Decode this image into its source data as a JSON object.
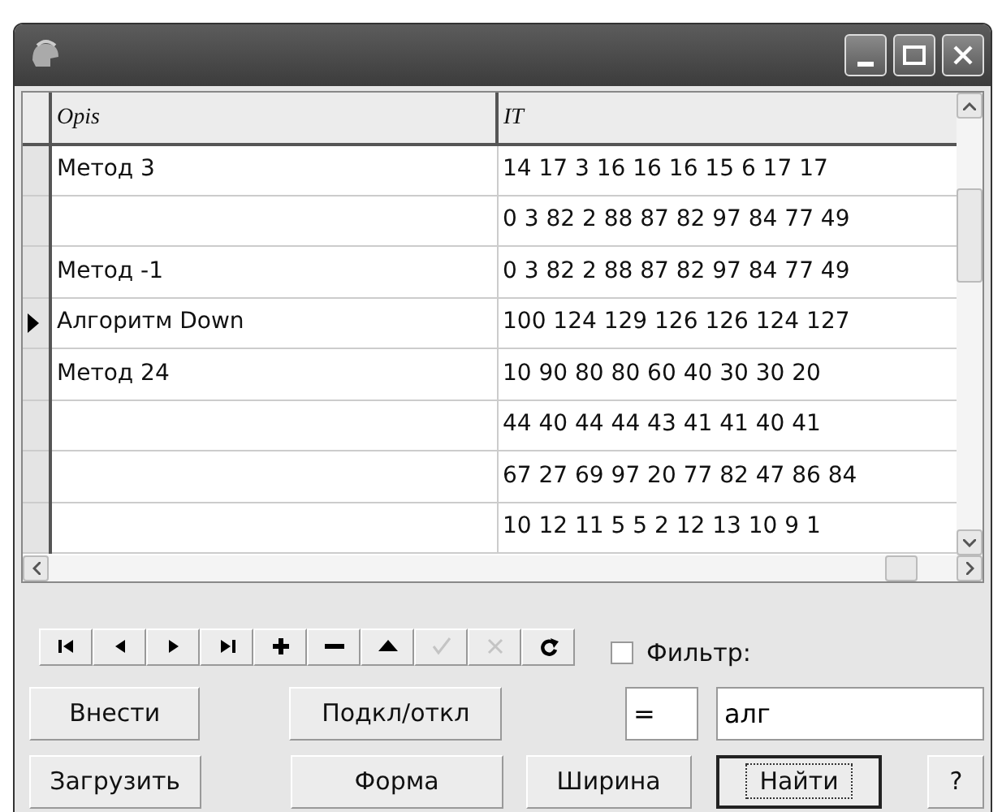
{
  "table": {
    "columns": [
      "Opis",
      "IT"
    ],
    "rows": [
      {
        "opis": "Метод 3",
        "it": "14 17 3 16 16 16 15 6 17 17",
        "current": false
      },
      {
        "opis": "",
        "it": "0 3 82 2 88 87 82 97 84 77 49",
        "current": false
      },
      {
        "opis": "Метод -1",
        "it": "0 3 82 2 88 87 82 97 84 77 49",
        "current": false
      },
      {
        "opis": "Алгоритм Down",
        "it": "100 124 129 126 126 124 127",
        "current": true
      },
      {
        "opis": "Метод 24",
        "it": "10 90 80 80 60 40 30 30 20",
        "current": false
      },
      {
        "opis": "",
        "it": "44 40 44 44 43 41 41 40 41",
        "current": false
      },
      {
        "opis": "",
        "it": "67 27 69 97 20 77 82 47 86 84",
        "current": false
      },
      {
        "opis": "",
        "it": "10 12 11 5 5 2 12 13 10 9 1",
        "current": false
      }
    ]
  },
  "navigator": [
    {
      "kind": "first",
      "disabled": false
    },
    {
      "kind": "prior",
      "disabled": false
    },
    {
      "kind": "next",
      "disabled": false
    },
    {
      "kind": "last",
      "disabled": false
    },
    {
      "kind": "insert",
      "disabled": false
    },
    {
      "kind": "delete",
      "disabled": false
    },
    {
      "kind": "edit",
      "disabled": false
    },
    {
      "kind": "post",
      "disabled": true
    },
    {
      "kind": "cancel",
      "disabled": true
    },
    {
      "kind": "refresh",
      "disabled": false
    }
  ],
  "filter": {
    "label": "Фильтр:",
    "checked": false
  },
  "operator_field": {
    "value": "="
  },
  "search_field": {
    "value": "алг"
  },
  "buttons": [
    {
      "label": "Внести",
      "default": false
    },
    {
      "label": "Подкл/откл",
      "default": false
    },
    {
      "label": "Загрузить",
      "default": false
    },
    {
      "label": "Форма",
      "default": false
    },
    {
      "label": "Ширина",
      "default": false
    },
    {
      "label": "Найти",
      "default": true
    },
    {
      "label": "?",
      "default": false
    }
  ]
}
